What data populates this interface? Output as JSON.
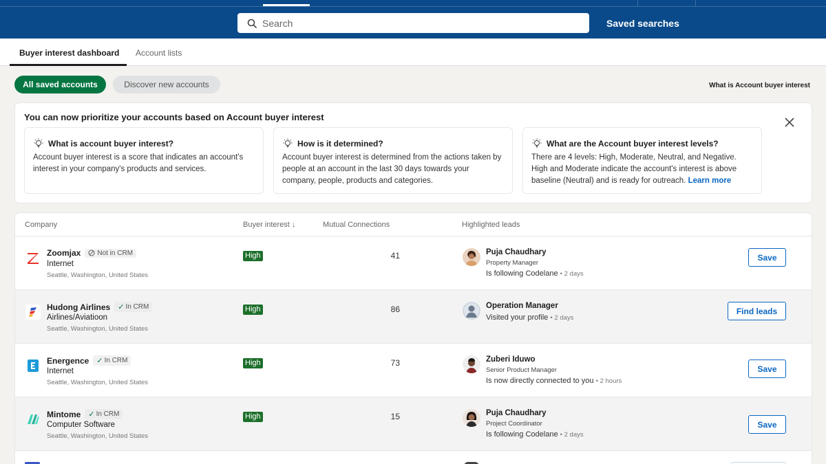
{
  "search": {
    "placeholder": "Search"
  },
  "header": {
    "saved_searches": "Saved searches"
  },
  "tabs": [
    {
      "label": "Buyer interest dashboard",
      "active": true
    },
    {
      "label": "Account lists",
      "active": false
    }
  ],
  "filters": {
    "all_saved": "All saved accounts",
    "discover": "Discover new accounts"
  },
  "help_link": "What is Account buyer interest",
  "banner": {
    "title": "You can now prioritize your accounts based on Account buyer interest",
    "cards": [
      {
        "title": "What is account buyer interest?",
        "body": "Account buyer interest is a score that indicates an account's interest in your company's products and services."
      },
      {
        "title": "How is it determined?",
        "body": "Account buyer interest is determined from the actions taken by people at an account in the last 30 days towards your company, people, products and categories."
      },
      {
        "title": "What are the Account buyer interest levels?",
        "body": "There are 4 levels: High, Moderate, Neutral, and Negative. High and Moderate indicate the account's interest is above baseline (Neutral) and is ready for outreach.",
        "link": "Learn more"
      }
    ]
  },
  "table": {
    "headers": {
      "company": "Company",
      "buyer_interest": "Buyer interest",
      "mutual": "Mutual Connections",
      "leads": "Highlighted leads"
    },
    "rows": [
      {
        "company": "Zoomjax",
        "crm": "Not in CRM",
        "industry": "Internet",
        "location": "Seattle, Washington, United States",
        "interest": "High",
        "mutual": "41",
        "lead_name": "Puja Chaudhary",
        "lead_title": "Property Manager",
        "activity": "Is following Codelane",
        "time": "2 days",
        "button": "Save"
      },
      {
        "company": "Hudong Airlines",
        "crm": "In CRM",
        "industry": "Airlines/Aviatioon",
        "location": "Seattle, Washington, United States",
        "interest": "High",
        "mutual": "86",
        "lead_name": "Operation Manager",
        "lead_title": "",
        "activity": "Visited your profile",
        "time": "2 days",
        "button": "Find leads"
      },
      {
        "company": "Energence",
        "crm": "In CRM",
        "industry": "Internet",
        "location": "Seattle, Washington, United States",
        "interest": "High",
        "mutual": "73",
        "lead_name": "Zuberi Iduwo",
        "lead_title": "Senior Product Manager",
        "activity": "Is now directly connected to you",
        "time": "2 hours",
        "button": "Save"
      },
      {
        "company": "Mintome",
        "crm": "In CRM",
        "industry": "Computer Software",
        "location": "Seattle, Washington, United States",
        "interest": "High",
        "mutual": "15",
        "lead_name": "Puja Chaudhary",
        "lead_title": "Project Coordinator",
        "activity": "Is following Codelane",
        "time": "2 days",
        "button": "Save"
      }
    ]
  },
  "colors": {
    "header_bg": "#0a4a8a",
    "accent_green": "#057642",
    "badge_green": "#1d6f2b",
    "link_blue": "#0a66c2"
  }
}
